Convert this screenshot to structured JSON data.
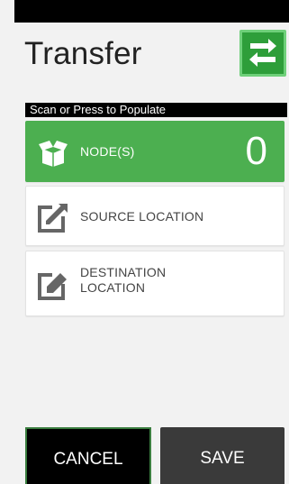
{
  "header": {
    "title": "Transfer",
    "action_icon": "transfer-arrows-icon",
    "accent_color": "#2e9e3a"
  },
  "hint": "Scan or Press to Populate",
  "fields": [
    {
      "label": "NODE(S)",
      "icon": "open-box-icon",
      "count": "0",
      "color": "#4caf50"
    },
    {
      "label": "SOURCE LOCATION",
      "icon": "edit-external-icon"
    },
    {
      "label_line1": "DESTINATION",
      "label_line2": "LOCATION",
      "icon": "edit-document-icon"
    }
  ],
  "buttons": {
    "cancel": "CANCEL",
    "save": "SAVE"
  }
}
